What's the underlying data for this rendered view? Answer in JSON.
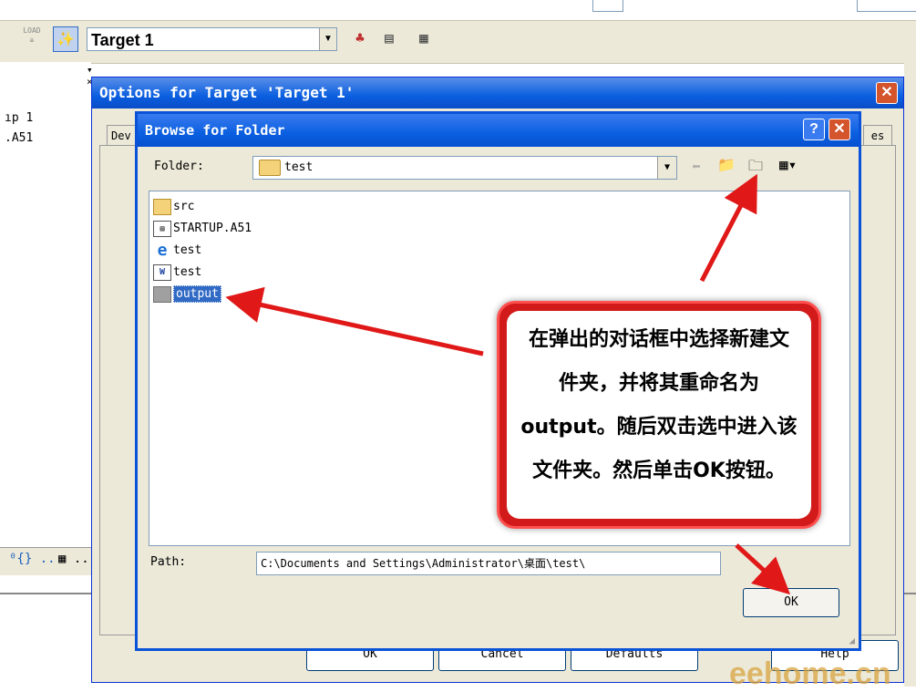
{
  "toolbar": {
    "target_select": "Target 1",
    "load_label": "LOAD"
  },
  "project": {
    "line1": "ıp 1",
    "line2": ".A51"
  },
  "options_dialog": {
    "title": "Options for Target 'Target 1'",
    "tab_left": "Dev",
    "tab_right": "es",
    "buttons": {
      "ok": "OK",
      "cancel": "Cancel",
      "defaults": "Defaults",
      "help": "Help"
    }
  },
  "browse_dialog": {
    "title": "Browse for Folder",
    "folder_label": "Folder:",
    "folder_value": "test",
    "help_btn": "?",
    "items": [
      {
        "name": "src",
        "icon": "folder-icon"
      },
      {
        "name": "STARTUP.A51",
        "icon": "asm-file-icon"
      },
      {
        "name": "test",
        "icon": "ie-file-icon"
      },
      {
        "name": "test",
        "icon": "uv-file-icon"
      },
      {
        "name": "output",
        "icon": "folder-icon",
        "selected": true
      }
    ],
    "path_label": "Path:",
    "path_value": "C:\\Documents and Settings\\Administrator\\桌面\\test\\",
    "ok": "OK"
  },
  "callout": {
    "text": "在弹出的对话框中选择新建文件夹，并将其重命名为output。随后双击选中进入该文件夹。然后单击OK按钮。"
  },
  "watermark": "eehome.cn",
  "colors": {
    "title_blue": "#0a5fe0",
    "callout_red": "#d21a1a",
    "arrow_red": "#e01818",
    "selection": "#316ac5"
  }
}
